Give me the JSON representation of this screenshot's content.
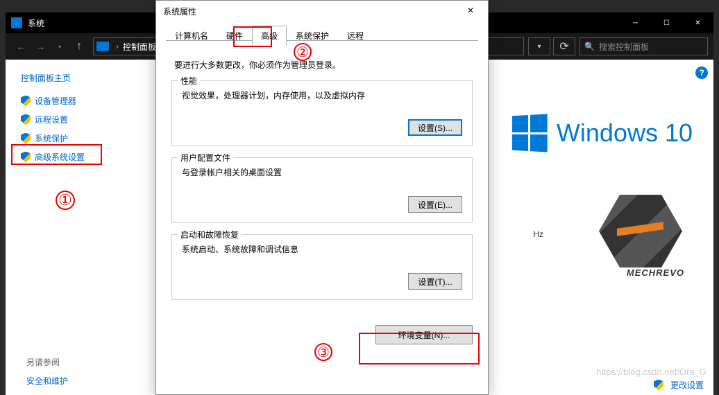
{
  "bg_window": {
    "title": "系统",
    "breadcrumb_item": "控制面板",
    "search_placeholder": "搜索控制面板"
  },
  "sidebar": {
    "title": "控制面板主页",
    "items": [
      "设备管理器",
      "远程设置",
      "系统保护",
      "高级系统设置"
    ],
    "footer_header": "另请参阅",
    "footer_link": "安全和维护"
  },
  "main": {
    "windows_text": "Windows 10",
    "hz_text": "Hz",
    "mechrevo": "MECHREVO",
    "change_link": "更改设置",
    "watermark": "https://blog.csdn.net/Ora_G"
  },
  "dialog": {
    "title": "系统属性",
    "close": "×",
    "tabs": [
      "计算机名",
      "硬件",
      "高级",
      "系统保护",
      "远程"
    ],
    "intro": "要进行大多数更改，你必须作为管理员登录。",
    "group1": {
      "title": "性能",
      "desc": "视觉效果，处理器计划，内存使用，以及虚拟内存",
      "btn": "设置(S)..."
    },
    "group2": {
      "title": "用户配置文件",
      "desc": "与登录帐户相关的桌面设置",
      "btn": "设置(E)..."
    },
    "group3": {
      "title": "启动和故障恢复",
      "desc": "系统启动、系统故障和调试信息",
      "btn": "设置(T)..."
    },
    "env_btn": "环境变量(N)..."
  },
  "annotations": {
    "one": "①",
    "two": "②",
    "three": "③"
  }
}
